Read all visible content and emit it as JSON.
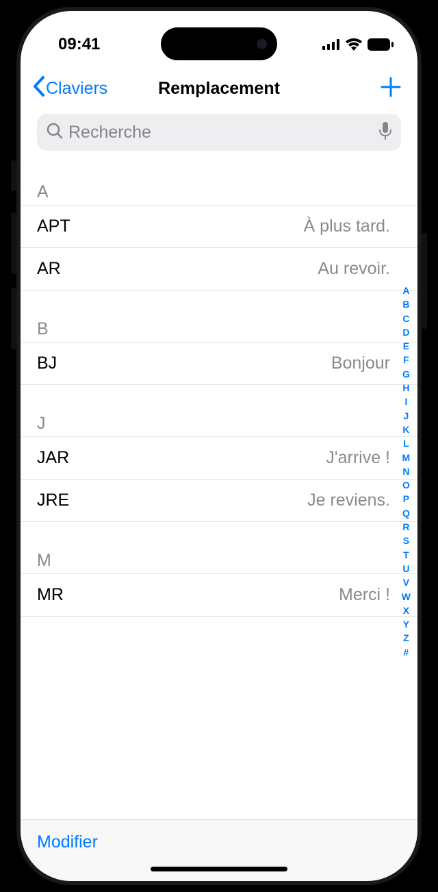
{
  "status": {
    "time": "09:41"
  },
  "nav": {
    "back_label": "Claviers",
    "title": "Remplacement"
  },
  "search": {
    "placeholder": "Recherche"
  },
  "sections": [
    {
      "letter": "A",
      "rows": [
        {
          "shortcut": "APT",
          "phrase": "À plus tard."
        },
        {
          "shortcut": "AR",
          "phrase": "Au revoir."
        }
      ]
    },
    {
      "letter": "B",
      "rows": [
        {
          "shortcut": "BJ",
          "phrase": "Bonjour"
        }
      ]
    },
    {
      "letter": "J",
      "rows": [
        {
          "shortcut": "JAR",
          "phrase": "J'arrive !"
        },
        {
          "shortcut": "JRE",
          "phrase": "Je reviens."
        }
      ]
    },
    {
      "letter": "M",
      "rows": [
        {
          "shortcut": "MR",
          "phrase": "Merci !"
        }
      ]
    }
  ],
  "index_letters": [
    "A",
    "B",
    "C",
    "D",
    "E",
    "F",
    "G",
    "H",
    "I",
    "J",
    "K",
    "L",
    "M",
    "N",
    "O",
    "P",
    "Q",
    "R",
    "S",
    "T",
    "U",
    "V",
    "W",
    "X",
    "Y",
    "Z",
    "#"
  ],
  "toolbar": {
    "modify_label": "Modifier"
  }
}
